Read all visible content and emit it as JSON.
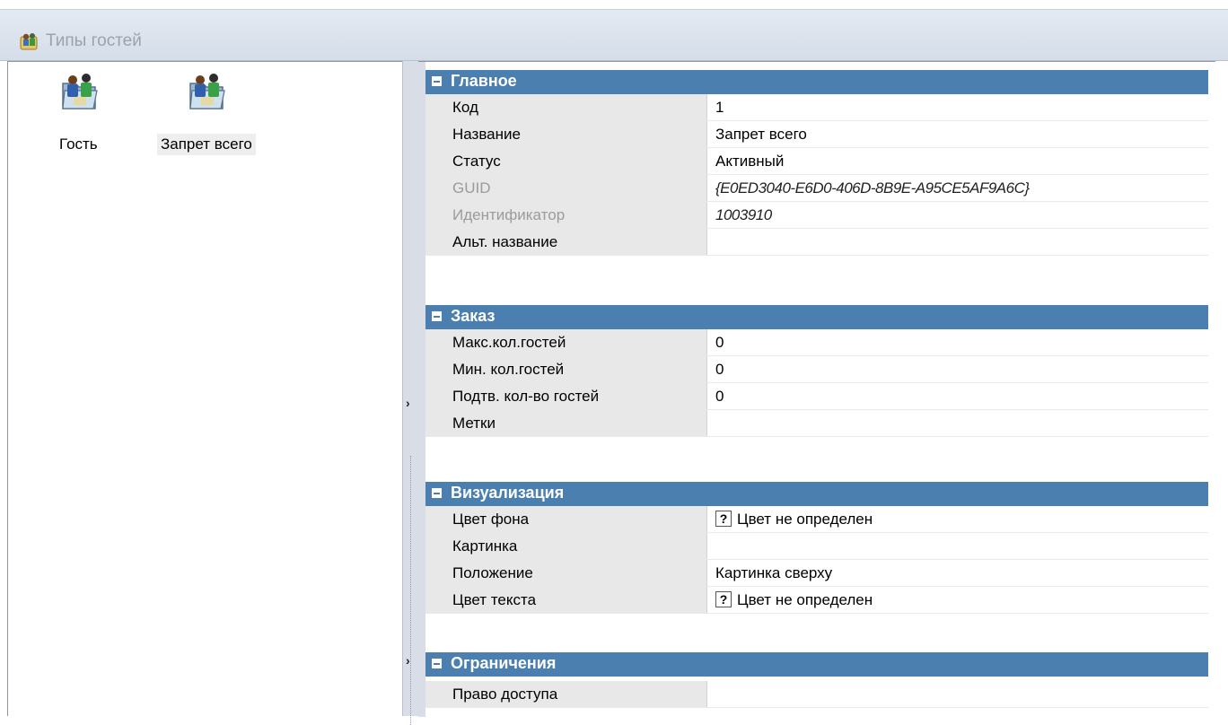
{
  "window": {
    "title": "Типы гостей"
  },
  "gallery": {
    "items": [
      {
        "label": "Гость",
        "selected": false
      },
      {
        "label": "Запрет всего",
        "selected": true
      }
    ]
  },
  "properties": {
    "groups": [
      {
        "title": "Главное",
        "rows": [
          {
            "name": "Код",
            "value": "1"
          },
          {
            "name": "Название",
            "value": "Запрет всего"
          },
          {
            "name": "Статус",
            "value": "Активный"
          },
          {
            "name": "GUID",
            "value": "{E0ED3040-E6D0-406D-8B9E-A95CE5AF9A6C}",
            "readonly": true
          },
          {
            "name": "Идентификатор",
            "value": "1003910",
            "readonly": true
          },
          {
            "name": "Альт. название",
            "value": ""
          }
        ]
      },
      {
        "title": "Заказ",
        "rows": [
          {
            "name": "Макс.кол.гостей",
            "value": "0"
          },
          {
            "name": "Мин. кол.гостей",
            "value": "0"
          },
          {
            "name": "Подтв. кол-во гостей",
            "value": "0"
          },
          {
            "name": "Метки",
            "value": ""
          }
        ]
      },
      {
        "title": "Визуализация",
        "rows": [
          {
            "name": "Цвет фона",
            "value": "Цвет не определен"
          },
          {
            "name": "Картинка",
            "value": ""
          },
          {
            "name": "Положение",
            "value": "Картинка сверху"
          },
          {
            "name": "Цвет текста",
            "value": "Цвет не определен"
          }
        ]
      },
      {
        "title": "Ограничения",
        "rows": [
          {
            "name": "Право доступа",
            "value": ""
          }
        ]
      }
    ]
  },
  "colors": {
    "category_header": "#4a7fb0",
    "name_cell": "#e8e8e8",
    "title_text": "#9aa3ad"
  },
  "icons": {
    "title": "guests-icon",
    "item": "guest-type-icon",
    "undefined_color": "question-mark-icon"
  }
}
